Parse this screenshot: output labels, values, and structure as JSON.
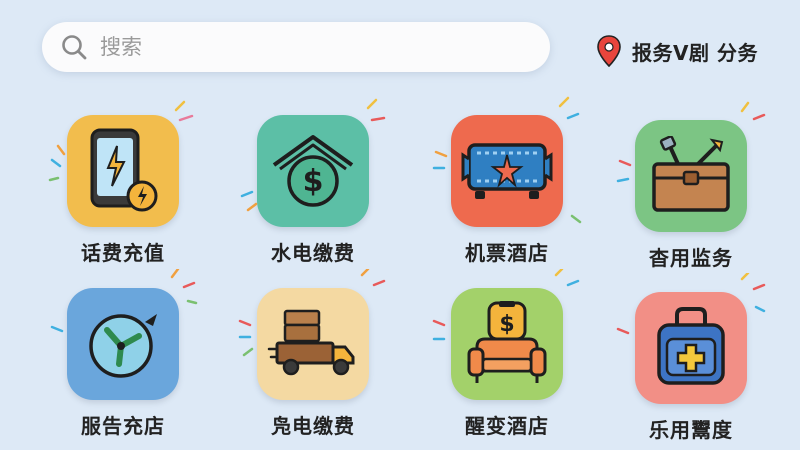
{
  "search": {
    "placeholder": "搜索"
  },
  "location": {
    "label": "报务V剧 分务"
  },
  "services": [
    {
      "label": "话费充值",
      "icon": "phone-charge-icon",
      "color": "#f2bd4d"
    },
    {
      "label": "水电缴费",
      "icon": "dollar-coin-icon",
      "color": "#5cbfa6"
    },
    {
      "label": "机票酒店",
      "icon": "ticket-icon",
      "color": "#ee6a4e"
    },
    {
      "label": "杳用监务",
      "icon": "toolbox-icon",
      "color": "#7cc584"
    },
    {
      "label": "服告充店",
      "icon": "plane-icon",
      "color": "#6aa6dc"
    },
    {
      "label": "凫电缴费",
      "icon": "truck-icon",
      "color": "#f4d9a2"
    },
    {
      "label": "醒变酒店",
      "icon": "armchair-icon",
      "color": "#a3d16a"
    },
    {
      "label": "乐用鬻度",
      "icon": "medical-bag-icon",
      "color": "#f28f86"
    }
  ]
}
